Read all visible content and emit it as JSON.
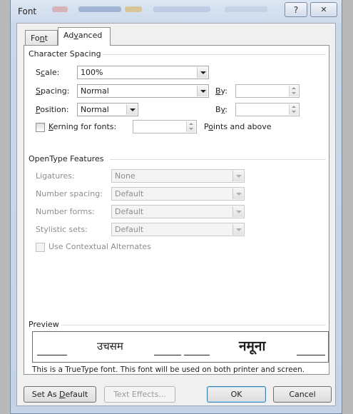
{
  "window": {
    "title": "Font",
    "help_glyph": "?",
    "close_glyph": "✕"
  },
  "tabs": [
    {
      "label": "Font",
      "mnemonic": "n"
    },
    {
      "label": "Advanced",
      "mnemonic": "v"
    }
  ],
  "character_spacing": {
    "title": "Character Spacing",
    "scale": {
      "label": "Scale:",
      "value": "100%"
    },
    "spacing": {
      "label": "Spacing:",
      "value": "Normal",
      "by_label": "By:",
      "by_value": ""
    },
    "position": {
      "label": "Position:",
      "value": "Normal",
      "by_label": "By:",
      "by_value": ""
    },
    "kerning": {
      "label": "Kerning for fonts:",
      "checked": false,
      "value": "",
      "suffix": "Points and above"
    }
  },
  "opentype": {
    "title": "OpenType Features",
    "ligatures": {
      "label": "Ligatures:",
      "value": "None"
    },
    "number_spacing": {
      "label": "Number spacing:",
      "value": "Default"
    },
    "number_forms": {
      "label": "Number forms:",
      "value": "Default"
    },
    "stylistic_sets": {
      "label": "Stylistic sets:",
      "value": "Default"
    },
    "contextual": {
      "label": "Use Contextual Alternates",
      "checked": false
    }
  },
  "preview": {
    "title": "Preview",
    "sample_left": "उचसम",
    "sample_right": "नमूना",
    "note": "This is a TrueType font. This font will be used on both printer and screen."
  },
  "buttons": {
    "set_default": "Set As Default",
    "text_effects": "Text Effects...",
    "ok": "OK",
    "cancel": "Cancel"
  },
  "colors": {
    "accent": "#3c7fb1",
    "disabled_text": "#8d8d8d"
  }
}
